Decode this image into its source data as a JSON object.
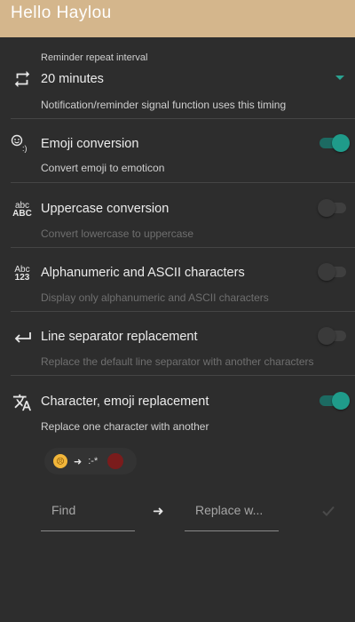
{
  "app": {
    "title": "Hello Haylou"
  },
  "colors": {
    "header": "#d4b68c",
    "background": "#2d2d2d",
    "accent": "#1f9b8a",
    "delete": "#7a1c1c"
  },
  "settings": {
    "repeat": {
      "label": "Reminder repeat interval",
      "value": "20 minutes",
      "desc": "Notification/reminder signal function uses this timing",
      "icon": "repeat-icon"
    },
    "emoji": {
      "title": "Emoji conversion",
      "desc": "Convert emoji to emoticon",
      "enabled": true,
      "icon": "emoji-icon"
    },
    "uppercase": {
      "title": "Uppercase conversion",
      "desc": "Convert lowercase to uppercase",
      "enabled": false,
      "icon": "abc-uppercase-icon",
      "icon_text_top": "abc",
      "icon_text_bottom": "ABC"
    },
    "alphanumeric": {
      "title": "Alphanumeric and ASCII characters",
      "desc": "Display only alphanumeric and ASCII characters",
      "enabled": false,
      "icon": "alphanumeric-icon",
      "icon_text_top": "Abc",
      "icon_text_bottom": "123"
    },
    "line_separator": {
      "title": "Line separator replacement",
      "desc": "Replace the default line separator with another characters",
      "enabled": false,
      "icon": "line-return-icon"
    },
    "char_replace": {
      "title": "Character, emoji replacement",
      "desc": "Replace one character with another",
      "enabled": true,
      "icon": "translate-icon"
    }
  },
  "replacement_rule": {
    "from": "😣",
    "arrow": "➜",
    "to": ":-*"
  },
  "fields": {
    "find_placeholder": "Find",
    "arrow": "➜",
    "replace_placeholder": "Replace w..."
  }
}
